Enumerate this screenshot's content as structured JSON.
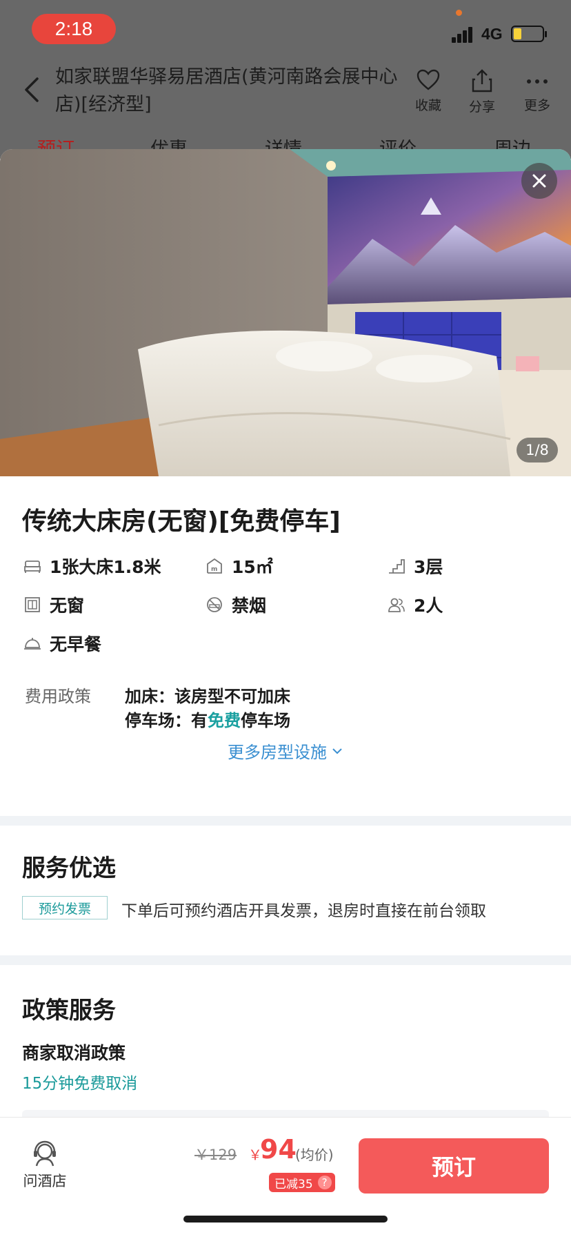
{
  "status_bar": {
    "time": "2:18",
    "network": "4G"
  },
  "header": {
    "title": "如家联盟华驿易居酒店(黄河南路会展中心店)[经济型]",
    "actions": [
      {
        "label": "收藏",
        "icon": "heart-icon"
      },
      {
        "label": "分享",
        "icon": "share-icon"
      },
      {
        "label": "更多",
        "icon": "more-icon"
      }
    ],
    "tabs": [
      "预订",
      "优惠",
      "详情",
      "评价",
      "周边"
    ]
  },
  "photo": {
    "counter": "1/8"
  },
  "room": {
    "name": "传统大床房(无窗)[免费停车]",
    "features": [
      {
        "text": "1张大床1.8米",
        "icon": "bed-icon"
      },
      {
        "text": "15㎡",
        "icon": "area-icon"
      },
      {
        "text": "3层",
        "icon": "stairs-icon"
      },
      {
        "text": "无窗",
        "icon": "window-icon"
      },
      {
        "text": "禁烟",
        "icon": "no-smoking-icon"
      },
      {
        "text": "2人",
        "icon": "guests-icon"
      },
      {
        "text": "无早餐",
        "icon": "dish-icon"
      }
    ],
    "policy_label": "费用政策",
    "policy_extra_bed": "加床：该房型不可加床",
    "policy_parking_prefix": "停车场：有",
    "policy_parking_free": "免费",
    "policy_parking_suffix": "停车场",
    "more_facilities": "更多房型设施"
  },
  "services": {
    "title": "服务优选",
    "tag": "预约发票",
    "desc": "下单后可预约酒店开具发票，退房时直接在前台领取"
  },
  "policy": {
    "title": "政策服务",
    "cancel_title": "商家取消政策",
    "cancel_link": "15分钟免费取消"
  },
  "bottom": {
    "ask": "问酒店",
    "original_price": "￥129",
    "currency": "￥",
    "price": "94",
    "avg": "(均价)",
    "discount": "已减35",
    "discount_help": "?",
    "book": "预订"
  },
  "colors": {
    "accent_red": "#f45a5a",
    "price_red": "#f04848",
    "teal": "#1a9a9a",
    "link_blue": "#3a8fd1"
  }
}
